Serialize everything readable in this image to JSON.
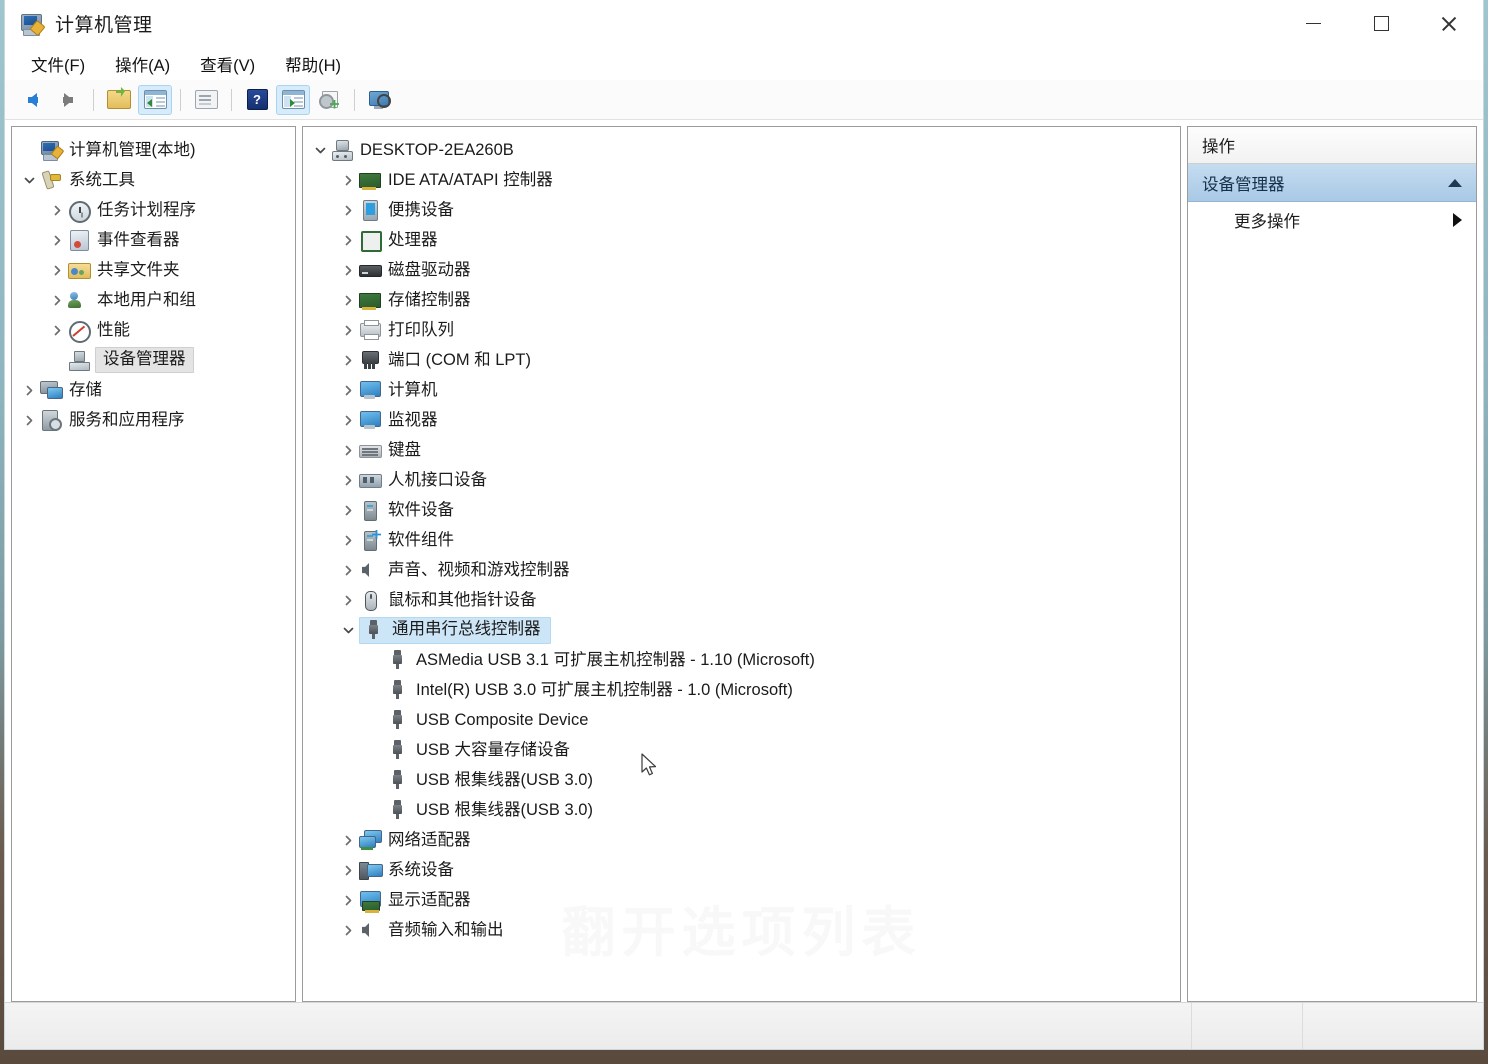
{
  "window": {
    "title": "计算机管理",
    "icon": "computer-management-icon",
    "minimize_label": "—",
    "maximize_label": "□",
    "close_label": "✕"
  },
  "menubar": {
    "items": [
      {
        "label": "文件(F)",
        "name": "menu-file"
      },
      {
        "label": "操作(A)",
        "name": "menu-action"
      },
      {
        "label": "查看(V)",
        "name": "menu-view"
      },
      {
        "label": "帮助(H)",
        "name": "menu-help"
      }
    ]
  },
  "toolbar": {
    "buttons": [
      {
        "name": "back-button",
        "icon": "back-arrow-icon",
        "tooltip": "后退"
      },
      {
        "name": "forward-button",
        "icon": "forward-arrow-icon",
        "tooltip": "前进"
      },
      {
        "name": "up-folder-button",
        "icon": "up-folder-icon",
        "tooltip": "向上"
      },
      {
        "name": "show-hide-console-tree-button",
        "icon": "console-tree-icon",
        "tooltip": "显示/隐藏控制台树",
        "active": true
      },
      {
        "name": "properties-button",
        "icon": "properties-icon",
        "tooltip": "属性"
      },
      {
        "name": "help-button",
        "icon": "help-icon",
        "tooltip": "帮助"
      },
      {
        "name": "show-hide-action-pane-button",
        "icon": "action-pane-icon",
        "tooltip": "显示/隐藏操作窗格",
        "active": true
      },
      {
        "name": "update-driver-button",
        "icon": "update-driver-icon",
        "tooltip": "更新驱动程序"
      },
      {
        "name": "scan-hardware-button",
        "icon": "scan-hardware-icon",
        "tooltip": "扫描检测硬件改动"
      }
    ]
  },
  "console_tree": {
    "root": {
      "label": "计算机管理(本地)",
      "icon": "computer-management-icon",
      "indent": 0,
      "expander": "none"
    },
    "items": [
      {
        "label": "系统工具",
        "icon": "system-tools-icon",
        "indent": 1,
        "expander": "expanded",
        "selected": false
      },
      {
        "label": "任务计划程序",
        "icon": "task-scheduler-icon",
        "indent": 2,
        "expander": "collapsed",
        "selected": false
      },
      {
        "label": "事件查看器",
        "icon": "event-viewer-icon",
        "indent": 2,
        "expander": "collapsed",
        "selected": false
      },
      {
        "label": "共享文件夹",
        "icon": "shared-folders-icon",
        "indent": 2,
        "expander": "collapsed",
        "selected": false
      },
      {
        "label": "本地用户和组",
        "icon": "local-users-groups-icon",
        "indent": 2,
        "expander": "collapsed",
        "selected": false
      },
      {
        "label": "性能",
        "icon": "performance-icon",
        "indent": 2,
        "expander": "collapsed",
        "selected": false
      },
      {
        "label": "设备管理器",
        "icon": "device-manager-icon",
        "indent": 2,
        "expander": "none",
        "selected": true
      },
      {
        "label": "存储",
        "icon": "storage-icon",
        "indent": 1,
        "expander": "collapsed",
        "selected": false
      },
      {
        "label": "服务和应用程序",
        "icon": "services-applications-icon",
        "indent": 1,
        "expander": "collapsed",
        "selected": false
      }
    ]
  },
  "device_tree": {
    "root": {
      "label": "DESKTOP-2EA260B",
      "icon": "computer-name-icon",
      "indent": 0,
      "expander": "expanded"
    },
    "items": [
      {
        "label": "IDE ATA/ATAPI 控制器",
        "icon": "ide-controller-icon",
        "indent": 1,
        "expander": "collapsed",
        "selected": false
      },
      {
        "label": "便携设备",
        "icon": "portable-device-icon",
        "indent": 1,
        "expander": "collapsed",
        "selected": false
      },
      {
        "label": "处理器",
        "icon": "processor-icon",
        "indent": 1,
        "expander": "collapsed",
        "selected": false
      },
      {
        "label": "磁盘驱动器",
        "icon": "disk-drive-icon",
        "indent": 1,
        "expander": "collapsed",
        "selected": false
      },
      {
        "label": "存储控制器",
        "icon": "storage-controller-icon",
        "indent": 1,
        "expander": "collapsed",
        "selected": false
      },
      {
        "label": "打印队列",
        "icon": "print-queue-icon",
        "indent": 1,
        "expander": "collapsed",
        "selected": false
      },
      {
        "label": "端口 (COM 和 LPT)",
        "icon": "ports-icon",
        "indent": 1,
        "expander": "collapsed",
        "selected": false
      },
      {
        "label": "计算机",
        "icon": "computer-icon",
        "indent": 1,
        "expander": "collapsed",
        "selected": false
      },
      {
        "label": "监视器",
        "icon": "monitor-icon",
        "indent": 1,
        "expander": "collapsed",
        "selected": false
      },
      {
        "label": "键盘",
        "icon": "keyboard-icon",
        "indent": 1,
        "expander": "collapsed",
        "selected": false
      },
      {
        "label": "人机接口设备",
        "icon": "hid-icon",
        "indent": 1,
        "expander": "collapsed",
        "selected": false
      },
      {
        "label": "软件设备",
        "icon": "software-device-icon",
        "indent": 1,
        "expander": "collapsed",
        "selected": false
      },
      {
        "label": "软件组件",
        "icon": "software-component-icon",
        "indent": 1,
        "expander": "collapsed",
        "selected": false
      },
      {
        "label": "声音、视频和游戏控制器",
        "icon": "sound-video-game-icon",
        "indent": 1,
        "expander": "collapsed",
        "selected": false
      },
      {
        "label": "鼠标和其他指针设备",
        "icon": "mouse-icon",
        "indent": 1,
        "expander": "collapsed",
        "selected": false
      },
      {
        "label": "通用串行总线控制器",
        "icon": "usb-controller-icon",
        "indent": 1,
        "expander": "expanded",
        "selected": true
      },
      {
        "label": "ASMedia USB 3.1 可扩展主机控制器 - 1.10 (Microsoft)",
        "icon": "usb-device-icon",
        "indent": 2,
        "expander": "none",
        "selected": false
      },
      {
        "label": "Intel(R) USB 3.0 可扩展主机控制器 - 1.0 (Microsoft)",
        "icon": "usb-device-icon",
        "indent": 2,
        "expander": "none",
        "selected": false
      },
      {
        "label": "USB Composite Device",
        "icon": "usb-device-icon",
        "indent": 2,
        "expander": "none",
        "selected": false
      },
      {
        "label": "USB 大容量存储设备",
        "icon": "usb-device-icon",
        "indent": 2,
        "expander": "none",
        "selected": false
      },
      {
        "label": "USB 根集线器(USB 3.0)",
        "icon": "usb-device-icon",
        "indent": 2,
        "expander": "none",
        "selected": false
      },
      {
        "label": "USB 根集线器(USB 3.0)",
        "icon": "usb-device-icon",
        "indent": 2,
        "expander": "none",
        "selected": false
      },
      {
        "label": "网络适配器",
        "icon": "network-adapter-icon",
        "indent": 1,
        "expander": "collapsed",
        "selected": false
      },
      {
        "label": "系统设备",
        "icon": "system-device-icon",
        "indent": 1,
        "expander": "collapsed",
        "selected": false
      },
      {
        "label": "显示适配器",
        "icon": "display-adapter-icon",
        "indent": 1,
        "expander": "collapsed",
        "selected": false
      },
      {
        "label": "音频输入和输出",
        "icon": "audio-io-icon",
        "indent": 1,
        "expander": "collapsed",
        "selected": false
      }
    ]
  },
  "actions_pane": {
    "header": "操作",
    "selected_group": "设备管理器",
    "collapse_icon": "triangle-up-icon",
    "rows": [
      {
        "label": "更多操作",
        "name": "more-actions-row",
        "icon": "triangle-right-icon"
      }
    ]
  },
  "watermark": "翻开选项列表",
  "colors": {
    "selection_blue": "#cde6f7",
    "selection_gray": "#e4e4e4",
    "actions_selected": "#b7d3ec",
    "accent": "#2a7fd4"
  }
}
